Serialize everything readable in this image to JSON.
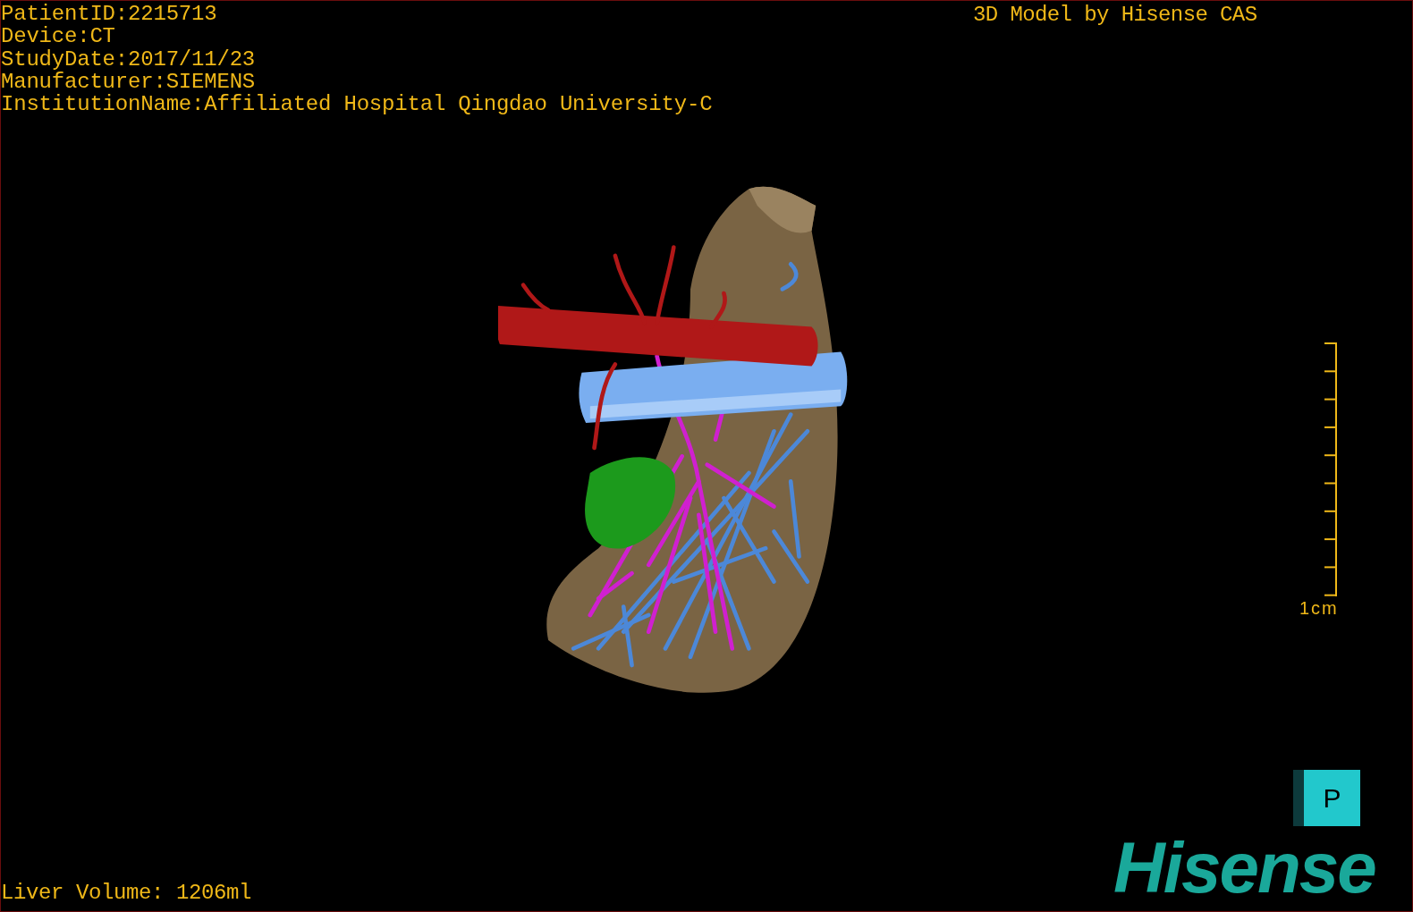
{
  "patient_info": [
    "PatientID:2215713",
    "Device:CT",
    "StudyDate:2017/11/23",
    "Manufacturer:SIEMENS",
    "InstitutionName:Affiliated Hospital Qingdao University-C"
  ],
  "model_credit": "3D Model by Hisense CAS",
  "scale_bar": {
    "label": "1cm"
  },
  "orientation_cube": {
    "face_label": "P"
  },
  "logo": "Hisense",
  "liver_volume": "Liver Volume: 1206ml"
}
